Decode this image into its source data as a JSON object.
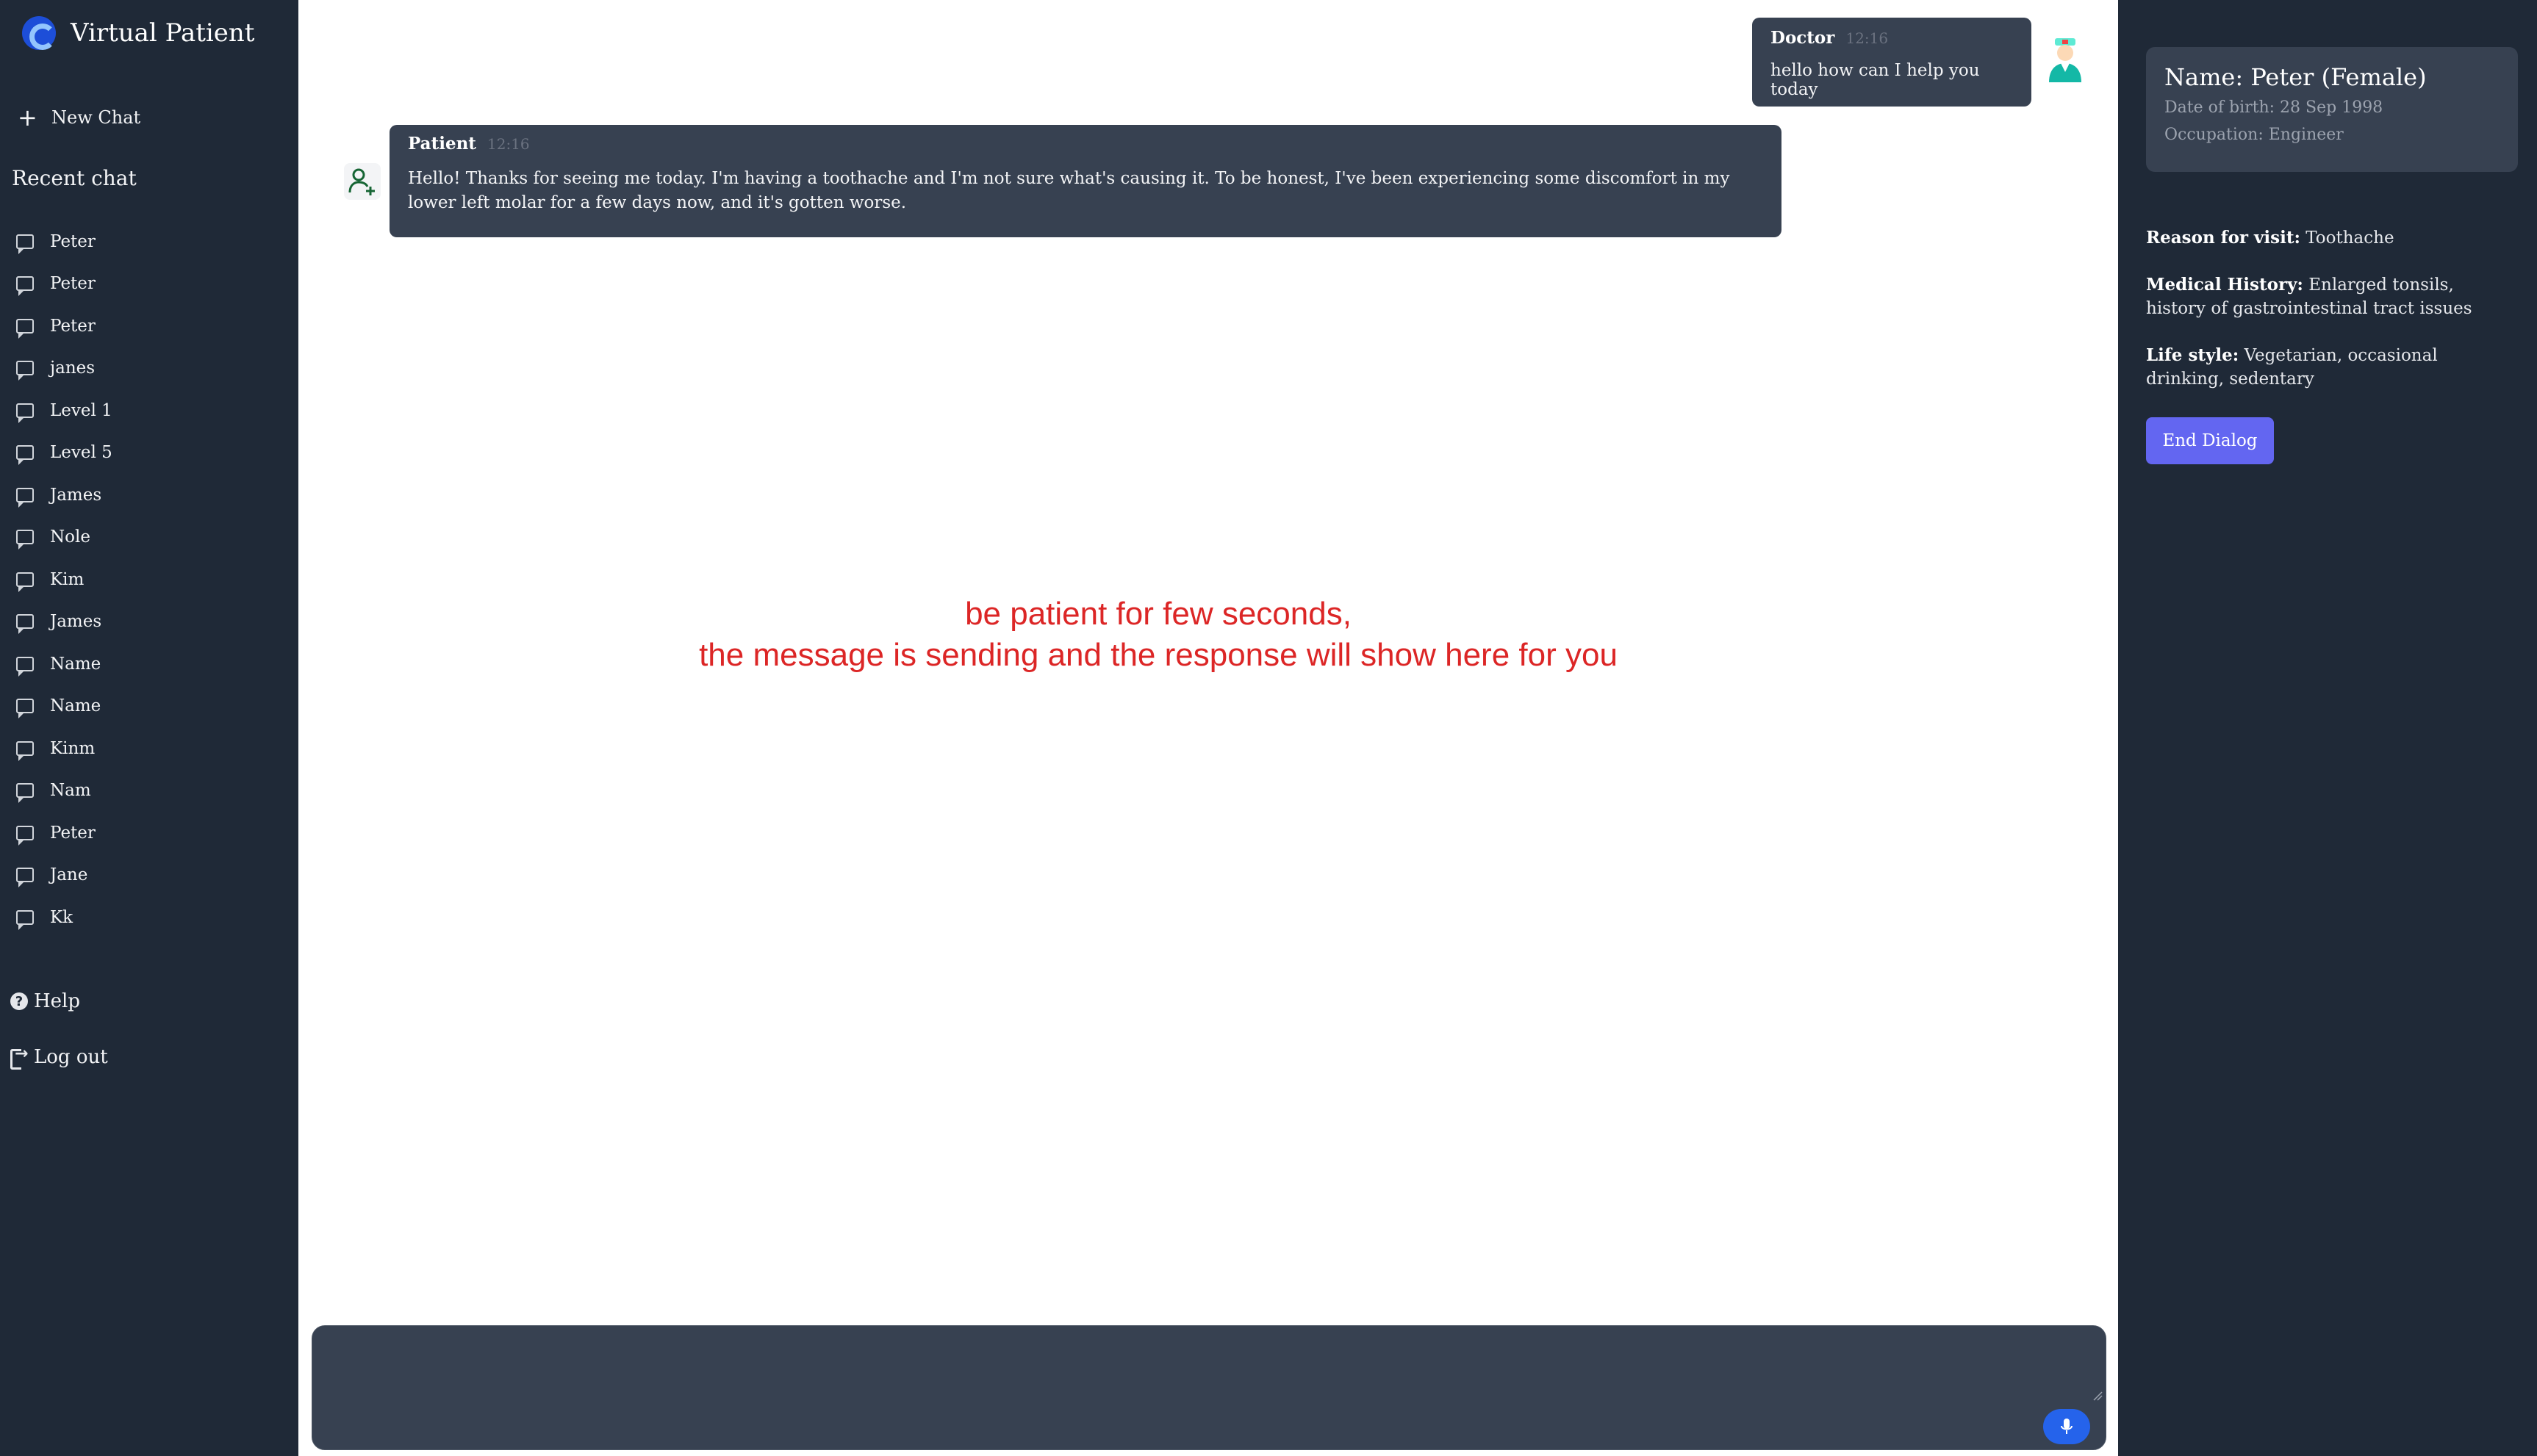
{
  "app": {
    "title": "Virtual Patient"
  },
  "sidebar": {
    "new_chat_label": "New Chat",
    "recent_heading": "Recent chat",
    "items": [
      {
        "label": "Peter"
      },
      {
        "label": "Peter"
      },
      {
        "label": "Peter"
      },
      {
        "label": "janes"
      },
      {
        "label": "Level 1"
      },
      {
        "label": "Level 5"
      },
      {
        "label": "James"
      },
      {
        "label": "Nole"
      },
      {
        "label": "Kim"
      },
      {
        "label": "James"
      },
      {
        "label": "Name"
      },
      {
        "label": "Name"
      },
      {
        "label": "Kinm"
      },
      {
        "label": "Nam"
      },
      {
        "label": "Peter"
      },
      {
        "label": "Jane"
      },
      {
        "label": "Kk"
      }
    ],
    "help_label": "Help",
    "logout_label": "Log out"
  },
  "chat": {
    "doctor_message": {
      "sender": "Doctor",
      "time": "12:16",
      "text": "hello how can I help you today"
    },
    "patient_message": {
      "sender": "Patient",
      "time": "12:16",
      "text": "Hello! Thanks for seeing me today. I'm having a toothache and I'm not sure what's causing it. To be honest, I've been experiencing some discomfort in my lower left molar for a few days now, and it's gotten worse."
    },
    "wait_line1": "be patient for few seconds,",
    "wait_line2": "the message is sending and the response will show here for you",
    "input_value": "",
    "mic_icon": "microphone-icon"
  },
  "patient_info": {
    "name": "Name: Peter (Female)",
    "dob": "Date of birth: 28 Sep 1998",
    "occupation": "Occupation: Engineer",
    "reason_label": "Reason for visit:",
    "reason_value": "Toothache",
    "history_label": "Medical History:",
    "history_value": "Enlarged tonsils, history of gastrointestinal tract issues",
    "lifestyle_label": "Life style:",
    "lifestyle_value": "Vegetarian, occasional drinking, sedentary",
    "end_button": "End Dialog"
  },
  "colors": {
    "sidebar_bg": "#1f2937",
    "bubble_bg": "#374151",
    "accent_button": "#6366f1",
    "mic_button": "#2563eb",
    "wait_text": "#dc2626"
  }
}
